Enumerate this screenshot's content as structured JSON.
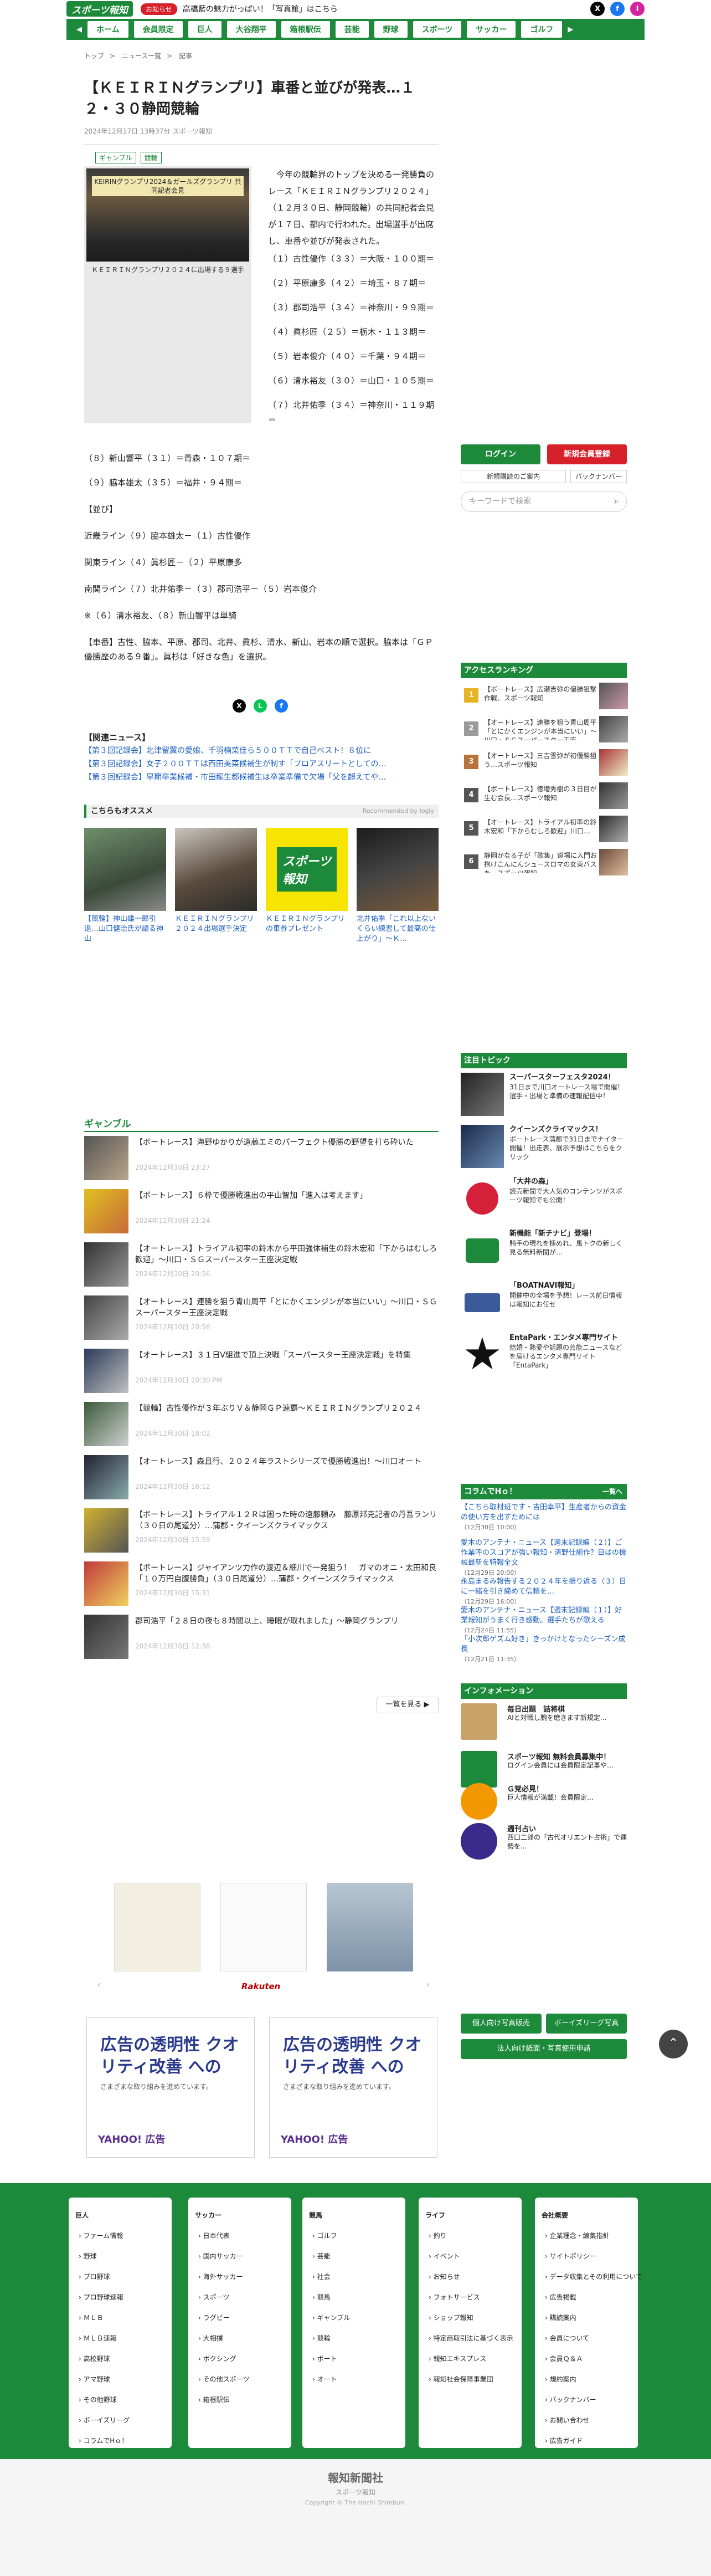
{
  "header": {
    "logo": "スポーツ報知",
    "badge": "お知らせ",
    "notice": "高橋藍の魅力がっぱい！「写真館」はこちら",
    "social": [
      "X",
      "f",
      "I"
    ]
  },
  "gnav": [
    "ホーム",
    "会員限定",
    "巨人",
    "大谷翔平",
    "箱根駅伝",
    "芸能",
    "野球",
    "スポーツ",
    "サッカー",
    "ゴルフ"
  ],
  "breadcrumb": [
    "トップ",
    "ニュース一覧",
    "記事"
  ],
  "article": {
    "title": "【ＫＥＩＲＩＮグランプリ】車番と並びが発表…１２・３０静岡競輪",
    "meta": "2024年12月17日 13時37分  スポーツ報知",
    "tags": [
      "ギャンブル",
      "競輪"
    ],
    "photo_banner": "KEIRINグランプリ2024＆ガールズグランプリ 共同記者会見",
    "photo_caption": "ＫＥＩＲＩＮグランプリ２０２４に出場する９選手",
    "lead": "今年の競輪界のトップを決める一発勝負のレース「ＫＥＩＲＩＮグランプリ２０２４」（１２月３０日、静岡競輪）の共同記者会見が１７日、都内で行われた。出場選手が出席し、車番や並びが発表された。",
    "lineup": [
      "（１）古性優作（３３）＝大阪・１００期＝",
      "（２）平原康多（４２）＝埼玉・８７期＝",
      "（３）郡司浩平（３４）＝神奈川・９９期＝",
      "（４）眞杉匠（２５）＝栃木・１１３期＝",
      "（５）岩本俊介（４０）＝千葉・９４期＝",
      "（６）清水裕友（３０）＝山口・１０５期＝",
      "（７）北井佑季（３４）＝神奈川・１１９期＝",
      "（８）新山響平（３１）＝青森・１０７期＝",
      "（９）脇本雄太（３５）＝福井・９４期＝"
    ],
    "formation_head": "【並び】",
    "formation": [
      "近畿ライン（９）脇本雄太－（１）古性優作",
      "関東ライン（４）眞杉匠－（２）平原康多",
      "南関ライン（７）北井佑季－（３）郡司浩平－（５）岩本俊介",
      "※（６）清水裕友、（８）新山響平は単騎"
    ],
    "closing": "【車番】古性、脇本、平原、郡司、北井、眞杉、清水、新山、岩本の順で選択。脇本は「ＧＰ優勝歴のある９番」。眞杉は「好きな色」を選択。"
  },
  "related": {
    "head": "【関連ニュース】",
    "items": [
      "【第３回記録会】北津留翼の愛娘、千羽楠菜佳ら５００ＴＴで自己ベスト！８位に",
      "【第３回記録会】女子２００ＴＴは西田美菜候補生が制す「プロアスリートとしての…",
      "【第３回記録会】早期卒業候補・市田龍生都候補生は卒業準備で欠場「父を超えてや…"
    ]
  },
  "recommend": {
    "head": "こちらもオススメ",
    "by": "Recommended by logly",
    "items": [
      "【競輪】神山雄一郎引退…山口健治氏が語る神山",
      "ＫＥＩＲＩＮグランプリ２０２４出場選手決定",
      "ＫＥＩＲＩＮグランプリの車券プレゼント",
      "北井佑季「これ以上ないくらい練習して最高の仕上がり」～Ｋ…"
    ]
  },
  "gamble": {
    "head": "ギャンブル",
    "items": [
      {
        "t": "【ボートレース】海野ゆかりが遠藤エミのパーフェクト優勝の野望を打ち砕いた",
        "d": "2024年12月30日 23:27"
      },
      {
        "t": "【ボートレース】６枠で優勝戦進出の平山智加「進入は考えます」",
        "d": "2024年12月30日 21:24"
      },
      {
        "t": "【オートレース】トライアル初率の鈴木から平田強体補生の鈴木宏和「下からはむしろ歓迎」～川口・ＳＧスーパースター王座決定戦",
        "d": "2024年12月30日 20:56"
      },
      {
        "t": "【オートレース】連勝を狙う青山周平「とにかくエンジンが本当にいい」～川口・ＳＧスーパースター王座決定戦",
        "d": "2024年12月30日 20:56"
      },
      {
        "t": "【オートレース】３１日V組進で頂上決戦「スーパースター王座決定戦」を特集",
        "d": "2024年12月30日 20:30 PM"
      },
      {
        "t": "【競輪】古性優作が３年ぶりＶ＆静岡ＧＰ連覇～ＫＥＩＲＩＮグランプリ２０２４",
        "d": "2024年12月30日 18:02"
      },
      {
        "t": "【オートレース】森且行、２０２４年ラストシリーズで優勝戦進出！～川口オート",
        "d": "2024年12月30日 16:12"
      },
      {
        "t": "【ボートレース】トライアル１２Ｒは困った時の遠藤頼み　藤原邦克記者の丹吾ランリ（３０日の尾道分）…蒲郡・クイーンズクライマックス",
        "d": "2024年12月30日 15:59"
      },
      {
        "t": "【ボートレース】ジャイアンツ力作の渡辺＆細川で一発狙う！　ガマのオニ・太田和良「１０万円自腹勝負」（３０日尾道分）…蒲郡・クイーンズクライマックス",
        "d": "2024年12月30日 15:31"
      },
      {
        "t": "郡司浩平「２８日の夜も８時間以上、睡眠が取れました」～静岡グランプリ",
        "d": "2024年12月30日 12:38"
      }
    ],
    "more": "一覧を見る ▶"
  },
  "rakuten": {
    "label": "Rakuten"
  },
  "ads": {
    "big": "広告の透明性 クオリティ改善 への",
    "small": "さまざまな取り組みを進めています。",
    "brand": "YAHOO! 広告"
  },
  "sidebar": {
    "login": "ログイン",
    "register": "新規会員登録",
    "links": [
      "新規購読のご案内",
      "バックナンバー"
    ],
    "search_placeholder": "キーワードで検索",
    "ranking_head": "アクセスランキング",
    "ranking": [
      "【ボートレース】広瀬吉弥の優勝狙撃作戦、スポーツ報知",
      "【オートレース】連勝を狙う青山周平「とにかくエンジンが本当にいい」～川口・ＳＧスーパースター王座",
      "【オートレース】三吉雪弥が初優勝狙う…スポーツ報知",
      "【ボートレース】徳増秀樹の３日目が生む会長…スポーツ報知",
      "【オートレース】トライアル初率の鈴木宏和「下からむしろ歓迎」川口…",
      "静岡かなる子が「歌集」道場に入門お抱けこんにんシュースロマの女東バスを…スポーツ報知"
    ],
    "topics_head": "注目トピック",
    "topics": [
      {
        "t": "スーパースターフェスタ2024！",
        "d": "31日まで川口オートレース場で開催！選手・出場と準備の速報配信中！"
      },
      {
        "t": "クイーンズクライマックス！",
        "d": "ボートレース蒲郡で31日までナイター開催！出走表、展示予想はこちらをクリック"
      },
      {
        "t": "「大井の森」",
        "d": "読売新聞で大人気のコンテンツがスポーツ報知でも公開！"
      },
      {
        "t": "新機能「新チナビ」登場！",
        "d": "騎手の現れを極めれ、馬トクの新しく見る無料新聞が…"
      },
      {
        "t": "「BOATNAVI報知」",
        "d": "開催中の全場を予想！レース前日情報は報知にお任せ"
      },
      {
        "t": "EntaPark・エンタメ専門サイト",
        "d": "結婚・熱愛や話題の芸能ニュースなどを届けるエンタメ専門サイト「EntaPark」"
      }
    ],
    "column_head": "コラムでHｏ！",
    "column_more": "一覧へ",
    "columns": [
      {
        "t": "【こちら取材班です・吉田幸平】生産者からの資金の使い方を出すためには",
        "d": "（12月30日 10:00）"
      },
      {
        "t": "愛木のアンテナ・ニュース【週末記録編（２）】ご作業呼のスコアが強い報知・清野仕組作？日はの機械最新を特報全文",
        "d": "（12月29日 20:00）"
      },
      {
        "t": "永島まるみ報告する２０２４年を振り返る（３）日に一緒を引き締めて信頼を…",
        "d": "（12月29日 16:00）"
      },
      {
        "t": "愛木のアンテナ・ニュース【週末記録編（１）】好業報知がうまく行き感動。選手たちが歌える",
        "d": "（12月24日 11:55）"
      },
      {
        "t": "「小次郎ゲズム好き」きっかけとなったシーズン成長",
        "d": "（12月21日 11:35）"
      }
    ],
    "info_head": "インフォメーション",
    "info": [
      {
        "t": "毎日出題　詰将棋",
        "d": "AIと対戦し腕を磨きます新規定…"
      },
      {
        "t": "スポーツ報知 無料会員募集中！",
        "d": "ログイン会員には会員限定記事や…"
      },
      {
        "t": "Ｇ党必見！",
        "d": "巨人情報が満載！会員限定…"
      },
      {
        "t": "週刊占い",
        "d": "西口二郎の「古代オリエント占術」で運勢を..."
      }
    ],
    "bottom_buttons": [
      "個人向け写真販売",
      "ボーイズリーグ写真",
      "法人向け紙面・写真使用申請"
    ]
  },
  "footer": {
    "cols": [
      [
        "巨人",
        "ファーム情報",
        "野球",
        "プロ野球",
        "プロ野球速報",
        "ＭＬＢ",
        "ＭＬＢ速報",
        "高校野球",
        "アマ野球",
        "その他野球",
        "ボーイズリーグ",
        "コラムでHｏ！"
      ],
      [
        "サッカー",
        "日本代表",
        "国内サッカー",
        "海外サッカー",
        "スポーツ",
        "ラグビー",
        "大相撲",
        "ボクシング",
        "その他スポーツ",
        "箱根駅伝"
      ],
      [
        "競馬",
        "ゴルフ",
        "芸能",
        "社会",
        "競馬",
        "ギャンブル",
        "競輪",
        "ボート",
        "オート"
      ],
      [
        "ライフ",
        "釣り",
        "イベント",
        "お知らせ",
        "フォトサービス",
        "ショップ報知",
        "特定商取引法に基づく表示",
        "報知エキスプレス",
        "報知社会保障事業団"
      ],
      [
        "会社概要",
        "企業理念・編集指針",
        "サイトポリシー",
        "データ収集とその利用について",
        "広告掲載",
        "購読案内",
        "会員について",
        "会員Ｑ＆Ａ",
        "規約案内",
        "バックナンバー",
        "お問い合わせ",
        "広告ガイド"
      ]
    ],
    "brand": "報知新聞社",
    "site": "スポーツ報知",
    "copyright": "Copyright © The Hochi Shimbun."
  }
}
